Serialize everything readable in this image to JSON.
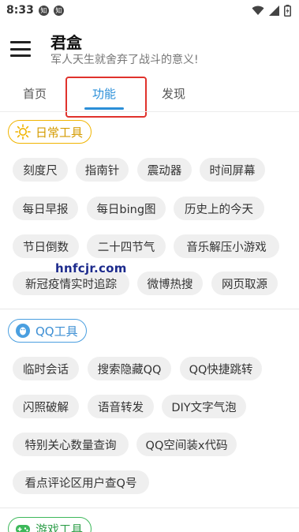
{
  "status_bar": {
    "time": "8:33",
    "notif_icons": [
      "知",
      "知"
    ]
  },
  "header": {
    "title": "君盒",
    "subtitle": "军人天生就舍弃了战斗的意义!"
  },
  "tabs": [
    {
      "label": "首页"
    },
    {
      "label": "功能",
      "active": true
    },
    {
      "label": "发现"
    }
  ],
  "sections": [
    {
      "title": "日常工具",
      "color": "#f0b400",
      "icon": "sun-icon",
      "items": [
        "刻度尺",
        "指南针",
        "震动器",
        "时间屏幕",
        "每日早报",
        "每日bing图",
        "历史上的今天",
        "节日倒数",
        "二十四节气",
        "音乐解压小游戏",
        "新冠疫情实时追踪",
        "微博热搜",
        "网页取源"
      ]
    },
    {
      "title": "QQ工具",
      "color": "#4a9fe0",
      "icon": "qq-penguin-icon",
      "items": [
        "临时会话",
        "搜索隐藏QQ",
        "QQ快捷跳转",
        "闪照破解",
        "语音转发",
        "DIY文字气泡",
        "特别关心数量查询",
        "QQ空间装x代码",
        "看点评论区用户查Q号"
      ]
    },
    {
      "title": "游戏工具",
      "color": "#3db85a",
      "icon": "game-controller-icon",
      "items": []
    }
  ],
  "watermark": "hnfcjr.com",
  "colors": {
    "accent": "#2b8fd8",
    "highlight_box": "#e0322c",
    "chip_bg": "#efefef"
  }
}
